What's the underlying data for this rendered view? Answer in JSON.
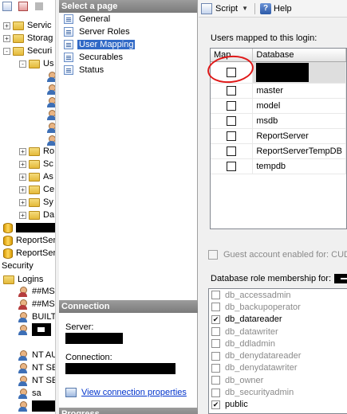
{
  "tree": {
    "items": [
      {
        "label": "Servic",
        "kind": "folder",
        "expander": "+"
      },
      {
        "label": "Storag",
        "kind": "folder",
        "expander": "+"
      },
      {
        "label": "Securi",
        "kind": "folder",
        "expander": "-"
      },
      {
        "label": "Us",
        "kind": "folder",
        "expander": "-"
      },
      {
        "label": "Ro",
        "kind": "folder",
        "expander": "+"
      },
      {
        "label": "Sc",
        "kind": "folder",
        "expander": "+"
      },
      {
        "label": "As",
        "kind": "folder",
        "expander": "+"
      },
      {
        "label": "Ce",
        "kind": "folder",
        "expander": "+"
      },
      {
        "label": "Sy",
        "kind": "folder",
        "expander": "+"
      },
      {
        "label": "Da",
        "kind": "folder",
        "expander": "+"
      },
      {
        "label": "ReportSer",
        "kind": "database"
      },
      {
        "label": "ReportSer",
        "kind": "database"
      },
      {
        "label": "Security",
        "kind": "text"
      },
      {
        "label": "Logins",
        "kind": "folder",
        "expander": "-"
      },
      {
        "label": "##MS",
        "kind": "login-red"
      },
      {
        "label": "##MS",
        "kind": "login-red"
      },
      {
        "label": "BUILT",
        "kind": "login"
      },
      {
        "label": "NT AU",
        "kind": "login"
      },
      {
        "label": "NT SE",
        "kind": "login"
      },
      {
        "label": "NT SE",
        "kind": "login"
      },
      {
        "label": "sa",
        "kind": "login"
      }
    ]
  },
  "pages": {
    "header": "Select a page",
    "items": [
      "General",
      "Server Roles",
      "User Mapping",
      "Securables",
      "Status"
    ],
    "selected": "User Mapping"
  },
  "connection": {
    "header": "Connection",
    "server_label": "Server:",
    "connection_label": "Connection:",
    "view_link": "View connection properties"
  },
  "progress": {
    "header": "Progress"
  },
  "toolbar": {
    "script_label": "Script",
    "help_label": "Help"
  },
  "users_mapped": {
    "label": "Users mapped to this login:",
    "columns": [
      "Map",
      "Database"
    ],
    "rows": [
      {
        "database": "",
        "mapped": false,
        "redacted": true
      },
      {
        "database": "master",
        "mapped": false
      },
      {
        "database": "model",
        "mapped": false
      },
      {
        "database": "msdb",
        "mapped": false
      },
      {
        "database": "ReportServer",
        "mapped": false
      },
      {
        "database": "ReportServerTempDB",
        "mapped": false
      },
      {
        "database": "tempdb",
        "mapped": false
      }
    ]
  },
  "guest": {
    "label": "Guest account enabled for: CUD",
    "checked": false,
    "enabled": false
  },
  "roles": {
    "label": "Database role membership for:",
    "items": [
      {
        "name": "db_accessadmin",
        "checked": false
      },
      {
        "name": "db_backupoperator",
        "checked": false
      },
      {
        "name": "db_datareader",
        "checked": true
      },
      {
        "name": "db_datawriter",
        "checked": false
      },
      {
        "name": "db_ddladmin",
        "checked": false
      },
      {
        "name": "db_denydatareader",
        "checked": false
      },
      {
        "name": "db_denydatawriter",
        "checked": false
      },
      {
        "name": "db_owner",
        "checked": false
      },
      {
        "name": "db_securityadmin",
        "checked": false
      },
      {
        "name": "public",
        "checked": true
      }
    ]
  },
  "colors": {
    "selection": "#3169c6",
    "annotation": "#e01818",
    "link": "#0033cc"
  }
}
